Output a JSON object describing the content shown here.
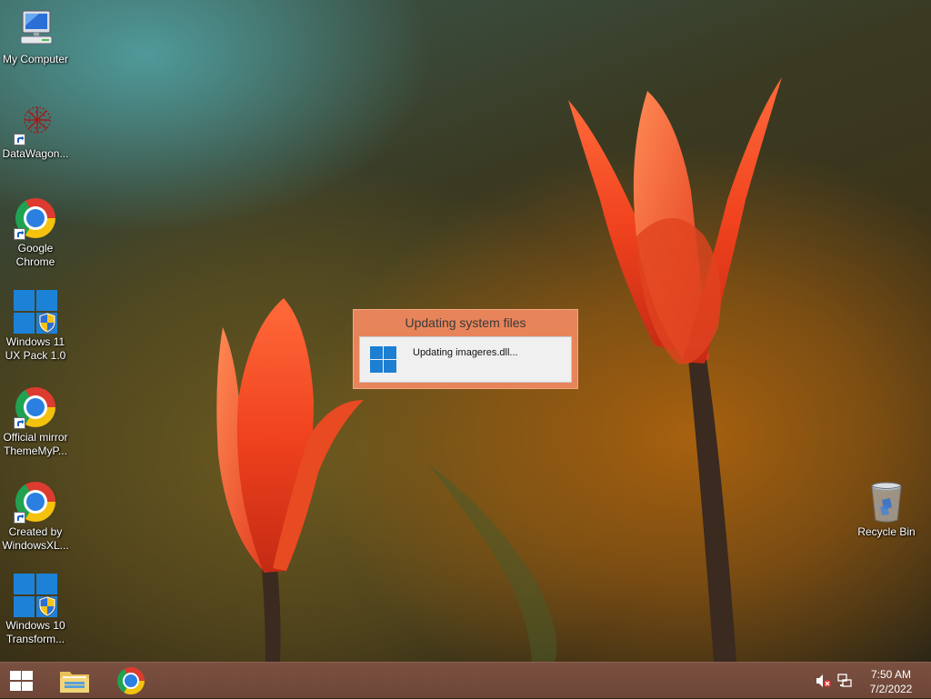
{
  "desktop": {
    "icons": [
      {
        "label": "My Computer",
        "icon": "computer-icon"
      },
      {
        "label": "DataWagon...",
        "icon": "datawagon-icon"
      },
      {
        "label": "Google Chrome",
        "icon": "chrome-icon"
      },
      {
        "label": "Windows 11 UX Pack 1.0",
        "icon": "windows-shield-icon"
      },
      {
        "label": "Official mirror ThemeMyP...",
        "icon": "chrome-icon"
      },
      {
        "label": "Created by WindowsXL...",
        "icon": "chrome-icon"
      },
      {
        "label": "Windows 10 Transform...",
        "icon": "windows-shield-icon"
      }
    ],
    "recycle_bin": {
      "label": "Recycle Bin",
      "icon": "recycle-bin-icon"
    }
  },
  "dialog": {
    "title": "Updating system files",
    "message": "Updating imageres.dll...",
    "accent": "#e8845a"
  },
  "taskbar": {
    "pinned": [
      {
        "name": "start",
        "icon": "windows-logo-icon"
      },
      {
        "name": "file-explorer",
        "icon": "folder-icon"
      },
      {
        "name": "google-chrome",
        "icon": "chrome-icon"
      }
    ],
    "tray": {
      "volume_icon": "volume-muted-icon",
      "network_icon": "network-icon",
      "time": "7:50 AM",
      "date": "7/2/2022"
    },
    "color": "#74493b"
  }
}
